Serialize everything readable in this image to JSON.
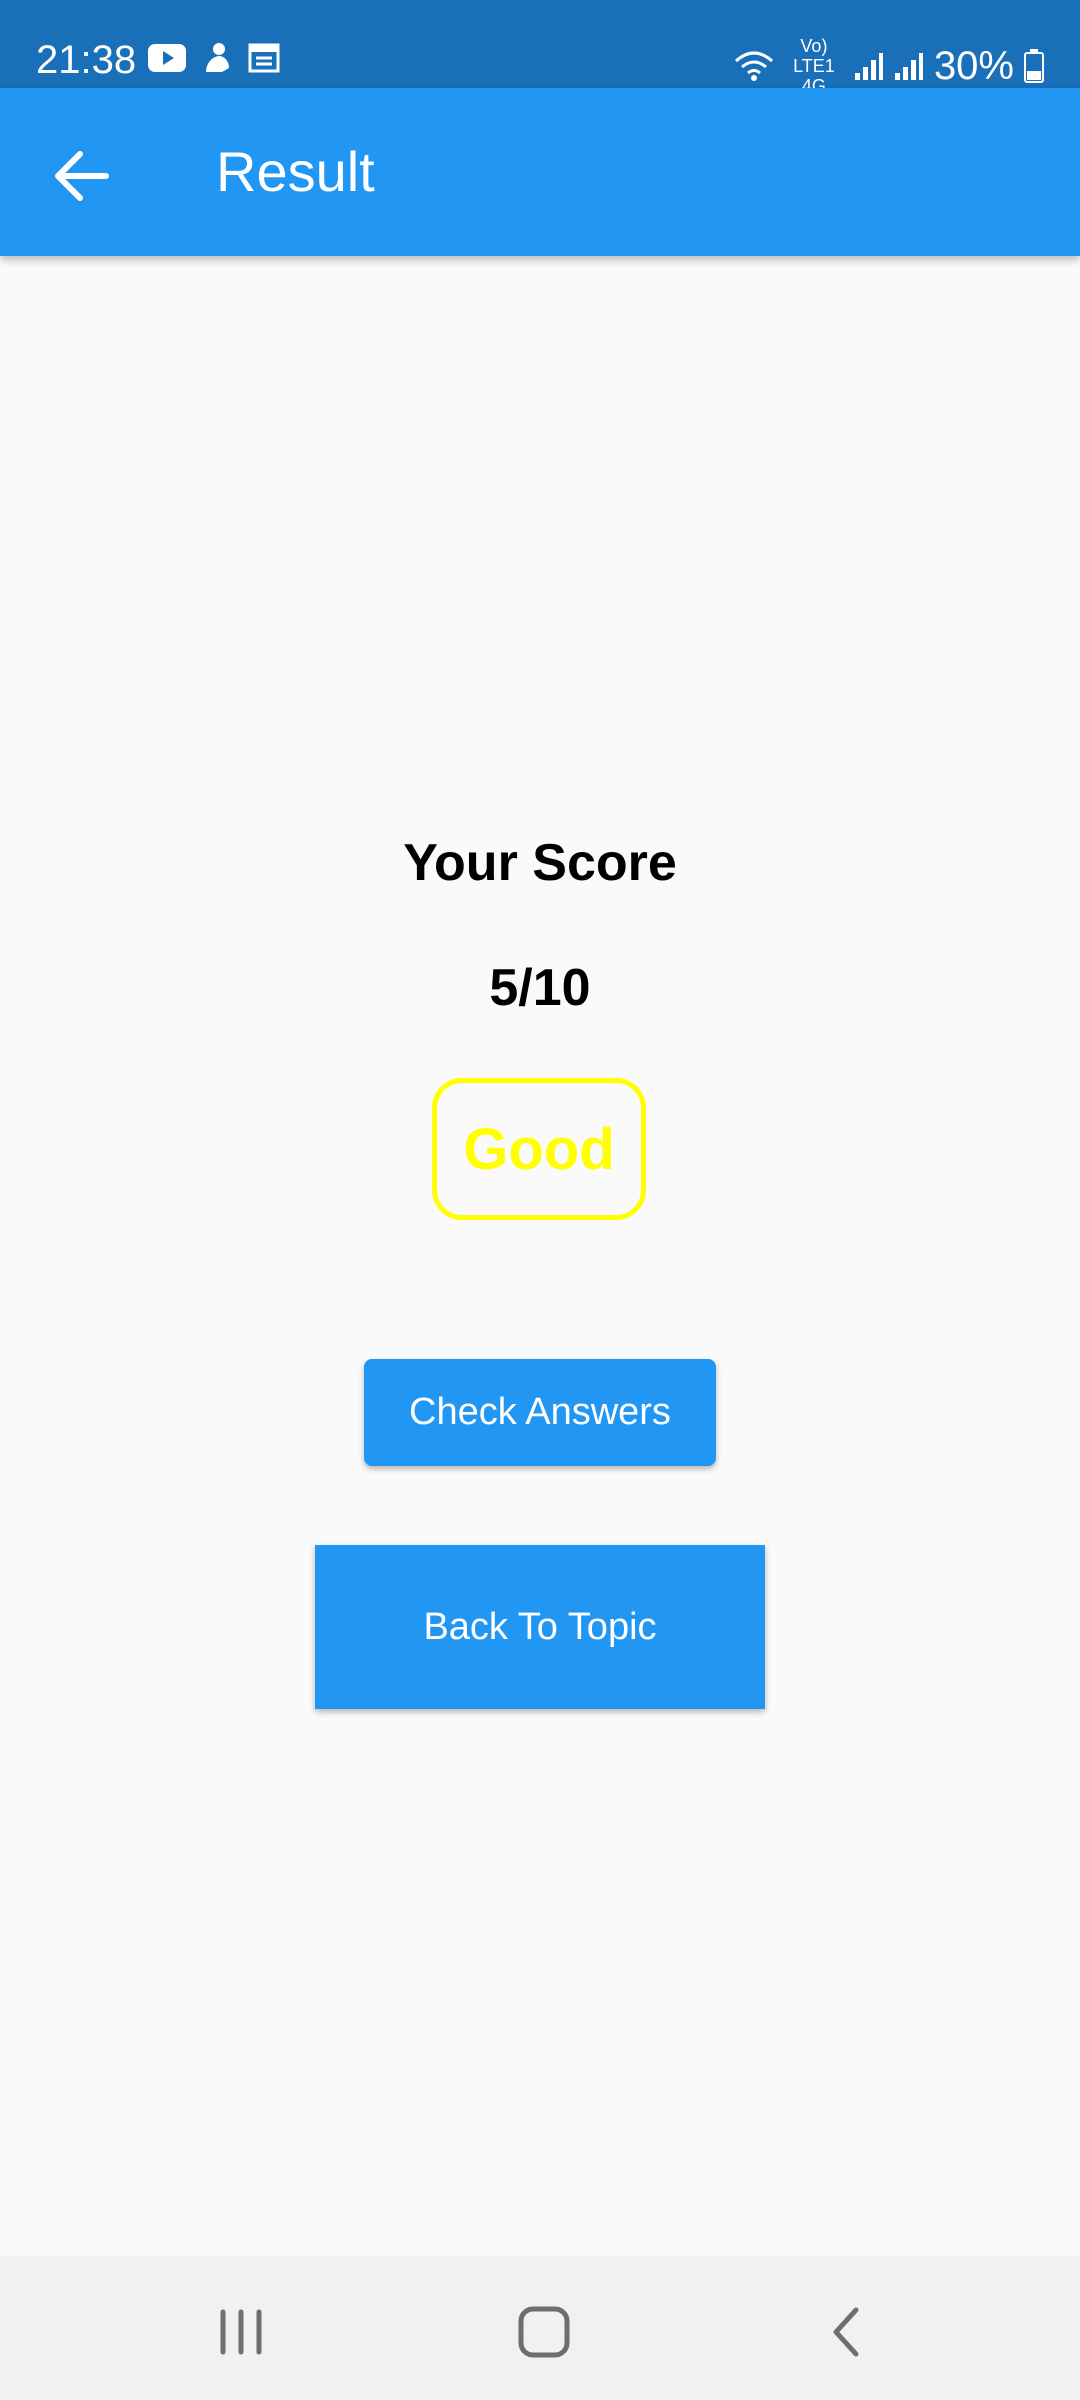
{
  "status_bar": {
    "time": "21:38",
    "network": "Vo) LTE1 4G",
    "battery": "30%",
    "icons": [
      "youtube-icon",
      "app-icon",
      "calendar-icon",
      "wifi-icon",
      "signal-icon",
      "battery-icon"
    ]
  },
  "app_bar": {
    "title": "Result",
    "back_icon": "arrow-left-icon"
  },
  "result": {
    "heading": "Your Score",
    "score": "5/10",
    "grade": "Good",
    "grade_color": "#ffff00"
  },
  "actions": {
    "check_answers": "Check Answers",
    "back_to_topic": "Back To Topic"
  },
  "colors": {
    "primary": "#2196f3",
    "status_bar": "#1a6fb9",
    "background": "#fafafa"
  },
  "nav_bar": {
    "items": [
      "recents-icon",
      "home-icon",
      "back-icon"
    ]
  }
}
